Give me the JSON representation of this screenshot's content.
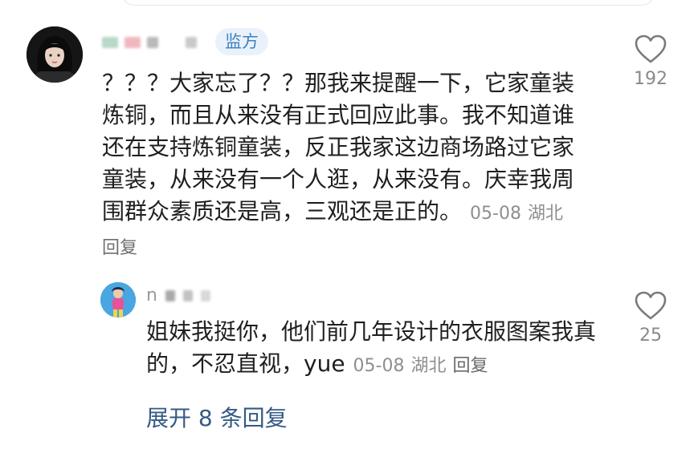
{
  "comment": {
    "badge": "监方",
    "text": "？？？大家忘了？？那我来提醒一下，它家童装炼铜，而且从来没有正式回应此事。我不知道谁还在支持炼铜童装，反正我家这边商场路过它家童装，从来没有一个人逛，从来没有。庆幸我周围群众素质还是高，三观还是正的。",
    "date": "05-08",
    "location": "湖北",
    "reply_label": "回复",
    "likes": "192"
  },
  "reply": {
    "name_prefix": "n",
    "text": "姐妹我挺你，他们前几年设计的衣服图案我真的，不忍直视，yue",
    "date": "05-08",
    "location": "湖北",
    "reply_label": "回复",
    "likes": "25"
  },
  "expand_label": "展开 8 条回复",
  "icons": {
    "like": "heart-outline-icon"
  },
  "colors": {
    "accent_link": "#345a86",
    "badge_bg": "#e9f2fb",
    "badge_text": "#3d7fc1",
    "meta_text": "#8f8f8f"
  }
}
